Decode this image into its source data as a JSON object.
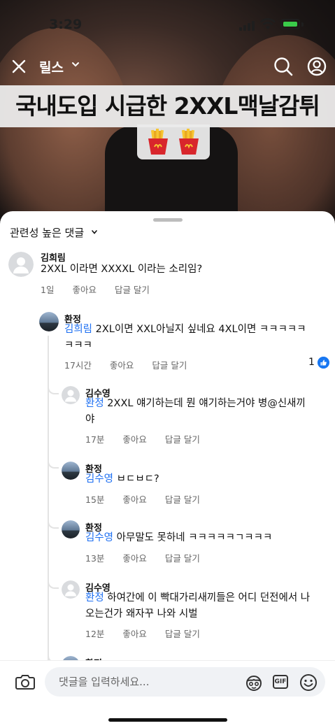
{
  "status_bar": {
    "time": "3:29"
  },
  "header": {
    "title": "릴스"
  },
  "video": {
    "caption": "국내도입 시급한 2XXL맥날감튀"
  },
  "comments_sheet": {
    "sort_label": "관련성 높은 댓글",
    "comments": [
      {
        "author": "김희림",
        "text": "2XXL 이라면 XXXXL 이라는 소리임?",
        "time": "1일",
        "like": "좋아요",
        "reply": "답글 달기"
      },
      {
        "author": "환정",
        "mention": "김희림",
        "text": " 2XL이면 XXL아닐지 싶네요 4XL이면 ㅋㅋㅋㅋㅋ",
        "text2": "ㅋㅋㅋ",
        "time": "17시간",
        "like": "좋아요",
        "reply": "답글 달기",
        "like_count": "1"
      },
      {
        "author": "김수영",
        "mention": "환정",
        "text": " 2XXL 얘기하는데 뭔 얘기하는거야 병@신새끼",
        "text2": "야",
        "time": "17분",
        "like": "좋아요",
        "reply": "답글 달기"
      },
      {
        "author": "환정",
        "mention": "김수영",
        "text": " ㅂㄷㅂㄷ?",
        "time": "15분",
        "like": "좋아요",
        "reply": "답글 달기"
      },
      {
        "author": "환정",
        "mention": "김수영",
        "text": " 아무말도 못하네 ㅋㅋㅋㅋㅋㄱㅋㅋㅋ",
        "time": "13분",
        "like": "좋아요",
        "reply": "답글 달기"
      },
      {
        "author": "김수영",
        "mention": "환정",
        "text": " 하여간에 이 빡대가리새끼들은 어디 던전에서 나",
        "text2": "오는건가 왜자꾸 나와 시벌",
        "time": "12분",
        "like": "좋아요",
        "reply": "답글 달기"
      },
      {
        "author": "환정"
      }
    ]
  },
  "input": {
    "placeholder": "댓글을 입력하세요..."
  },
  "colors": {
    "mention": "#1d6ff2",
    "like_badge": "#1877f2",
    "battery": "#3acb4a"
  }
}
